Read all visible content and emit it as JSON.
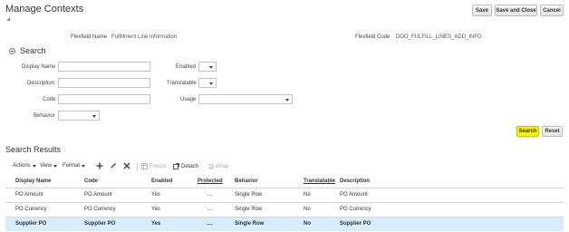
{
  "header": {
    "title": "Manage Contexts",
    "buttons": {
      "save": "Save",
      "save_close": "Save and Close",
      "cancel": "Cancel"
    }
  },
  "flexfield": {
    "name_label": "Flexfield Name",
    "name_value": "Fulfillment Line Information",
    "code_label": "Flexfield Code",
    "code_value": "DOO_FULFILL_LINES_ADD_INFO"
  },
  "search": {
    "title": "Search",
    "fields": {
      "display_name": "Display Name",
      "description": "Description",
      "code": "Code",
      "behavior": "Behavior",
      "enabled": "Enabled",
      "translatable": "Translatable",
      "usage": "Usage"
    },
    "buttons": {
      "search": "Search",
      "reset": "Reset"
    }
  },
  "results": {
    "title": "Search Results",
    "toolbar": {
      "actions": "Actions",
      "view": "View",
      "format": "Format",
      "freeze": "Freeze",
      "detach": "Detach",
      "wrap": "Wrap"
    },
    "columns": [
      "Display Name",
      "Code",
      "Enabled",
      "Protected",
      "Behavior",
      "Translatable",
      "Description"
    ],
    "rows": [
      [
        "PO Amount",
        "PO Amount",
        "Yes",
        "....",
        "Single Row",
        "No",
        "PO Amount"
      ],
      [
        "PO Currency",
        "PO Currency",
        "Yes",
        "....",
        "Single Row",
        "No",
        "PO Currency"
      ],
      [
        "Supplier PO",
        "Supplier PO",
        "Yes",
        "....",
        "Single Row",
        "No",
        "Supplier PO"
      ]
    ],
    "selected_row": 2
  },
  "colors": {
    "highlight_button": "#f2f21a",
    "selected_row": "#d9ecfb"
  }
}
